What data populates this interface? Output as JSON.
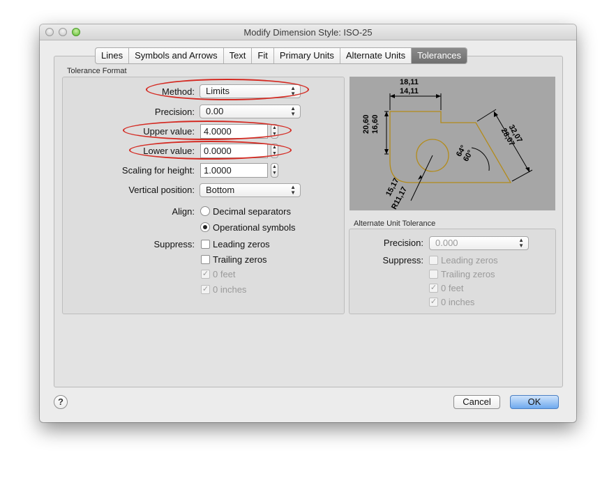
{
  "window": {
    "title": "Modify Dimension Style: ISO-25"
  },
  "tabs": [
    {
      "label": "Lines",
      "active": false
    },
    {
      "label": "Symbols and Arrows",
      "active": false
    },
    {
      "label": "Text",
      "active": false
    },
    {
      "label": "Fit",
      "active": false
    },
    {
      "label": "Primary Units",
      "active": false
    },
    {
      "label": "Alternate Units",
      "active": false
    },
    {
      "label": "Tolerances",
      "active": true
    }
  ],
  "tolerance_format": {
    "group_label": "Tolerance Format",
    "method": {
      "label": "Method:",
      "value": "Limits"
    },
    "precision": {
      "label": "Precision:",
      "value": "0.00"
    },
    "upper_value": {
      "label": "Upper value:",
      "value": "4.0000"
    },
    "lower_value": {
      "label": "Lower value:",
      "value": "0.0000"
    },
    "scaling_for_height": {
      "label": "Scaling for height:",
      "value": "1.0000"
    },
    "vertical_position": {
      "label": "Vertical position:",
      "value": "Bottom"
    },
    "align": {
      "label": "Align:",
      "options": [
        {
          "label": "Decimal separators",
          "selected": false
        },
        {
          "label": "Operational symbols",
          "selected": true
        }
      ]
    },
    "suppress": {
      "label": "Suppress:",
      "options": [
        {
          "label": "Leading zeros",
          "checked": false,
          "enabled": true
        },
        {
          "label": "Trailing zeros",
          "checked": false,
          "enabled": true
        },
        {
          "label": "0 feet",
          "checked": true,
          "enabled": false
        },
        {
          "label": "0 inches",
          "checked": true,
          "enabled": false
        }
      ]
    }
  },
  "preview": {
    "labels": {
      "top1": "18,11",
      "top2": "14,11",
      "left1": "20,60",
      "left2": "16,60",
      "right1": "32,07",
      "right2": "28,07",
      "angle1": "64°",
      "angle2": "60°",
      "radius1": "15,17",
      "radius2": "R11,17"
    }
  },
  "alternate_unit_tolerance": {
    "group_label": "Alternate Unit Tolerance",
    "precision": {
      "label": "Precision:",
      "value": "0.000"
    },
    "suppress": {
      "label": "Suppress:",
      "options": [
        {
          "label": "Leading zeros",
          "checked": false
        },
        {
          "label": "Trailing zeros",
          "checked": false
        },
        {
          "label": "0 feet",
          "checked": true
        },
        {
          "label": "0 inches",
          "checked": true
        }
      ]
    }
  },
  "buttons": {
    "help": "?",
    "cancel": "Cancel",
    "ok": "OK"
  },
  "icons": {
    "check": "✓",
    "popup_arrows": "▲▼"
  },
  "colors": {
    "annotation_ring": "#d42a22",
    "preview_outline": "#b38b1a",
    "default_button": "#6ea9ee"
  }
}
